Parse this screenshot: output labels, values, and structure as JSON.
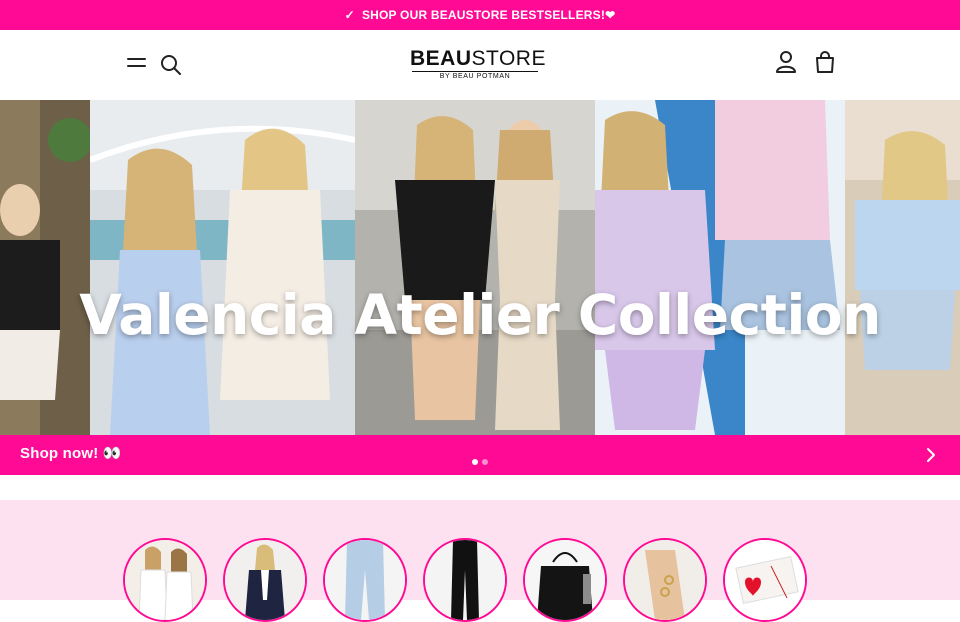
{
  "announcement": {
    "check_icon": "checkmark-icon",
    "text": "SHOP OUR BEAUSTORE BESTSELLERS!",
    "heart": "❤"
  },
  "header": {
    "logo_bold": "BEAU",
    "logo_light": "STORE",
    "logo_sub": "BY BEAU POTMAN",
    "menu_icon": "hamburger-menu-icon",
    "search_icon": "search-icon",
    "account_icon": "user-account-icon",
    "cart_icon": "shopping-bag-icon"
  },
  "hero": {
    "title": "Valencia Atelier Collection",
    "cta": "Shop now! 👀",
    "slides": [
      {
        "active": true
      },
      {
        "active": false
      }
    ],
    "next_icon": "chevron-right-icon"
  },
  "colors": {
    "brand_pink": "#ff0a94",
    "light_pink": "#fde1f1"
  },
  "categories": [
    {
      "icon": "two-women-white-tops-thumbnail"
    },
    {
      "icon": "woman-blazer-thumbnail"
    },
    {
      "icon": "light-jeans-thumbnail"
    },
    {
      "icon": "black-trousers-thumbnail"
    },
    {
      "icon": "black-tote-bag-thumbnail"
    },
    {
      "icon": "hand-rings-jewelry-thumbnail"
    },
    {
      "icon": "gift-card-heart-thumbnail"
    }
  ]
}
